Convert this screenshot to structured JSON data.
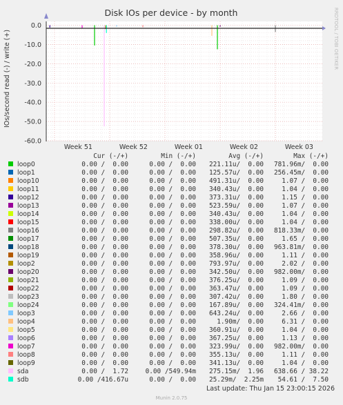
{
  "chart_data": {
    "type": "line",
    "title": "Disk IOs per device - by month",
    "ylabel": "IOs/second read (-) / write (+)",
    "side_label": "RRDTOOL / TOBI OETIKER",
    "ylim": [
      -60,
      2
    ],
    "y_ticks": [
      0,
      -10,
      -20,
      -30,
      -40,
      -50,
      -60
    ],
    "y_tick_labels": [
      "0.0",
      "-10.0",
      "-20.0",
      "-30.0",
      "-40.0",
      "-50.0",
      "-60.0"
    ],
    "x_ticks": [
      "Week 51",
      "Week 52",
      "Week 01",
      "Week 02",
      "Week 03"
    ],
    "grid": true,
    "spikes": [
      {
        "series": "loop12",
        "x": 0.013,
        "min": -1.2
      },
      {
        "series": "loop7",
        "x": 0.13,
        "min": -1.5
      },
      {
        "series": "loop0",
        "x": 0.175,
        "min": -10.5
      },
      {
        "series": "sda",
        "x": 0.21,
        "min": -52.5
      },
      {
        "series": "loop2",
        "x": 0.215,
        "min": -2.0
      },
      {
        "series": "sdb",
        "x": 0.218,
        "min": -4.0
      },
      {
        "series": "loop3",
        "x": 0.255,
        "min": -0.7
      },
      {
        "series": "loop8",
        "x": 0.35,
        "min": -1.0
      },
      {
        "series": "loop4",
        "x": 0.6,
        "min": -5.5
      },
      {
        "series": "loop0",
        "x": 0.62,
        "min": -12.5
      },
      {
        "series": "loop20",
        "x": 0.63,
        "min": -0.8
      },
      {
        "series": "loop16",
        "x": 0.83,
        "min": -3.5
      }
    ]
  },
  "legend": {
    "headers": {
      "cur": "Cur (-/+)",
      "min": "Min (-/+)",
      "avg": "Avg (-/+)",
      "max": "Max (-/+)"
    },
    "rows": [
      {
        "name": "loop0",
        "color": "#00cc00",
        "cur": "0.00 /  0.00",
        "min": "0.00 /  0.00",
        "avg": "221.11u/  0.00",
        "max": "781.96m/  0.00"
      },
      {
        "name": "loop1",
        "color": "#0066b3",
        "cur": "0.00 /  0.00",
        "min": "0.00 /  0.00",
        "avg": "125.57u/  0.00",
        "max": "256.45m/  0.00"
      },
      {
        "name": "loop10",
        "color": "#ff8000",
        "cur": "0.00 /  0.00",
        "min": "0.00 /  0.00",
        "avg": "491.31u/  0.00",
        "max": "1.07 /  0.00"
      },
      {
        "name": "loop11",
        "color": "#ffcc00",
        "cur": "0.00 /  0.00",
        "min": "0.00 /  0.00",
        "avg": "340.43u/  0.00",
        "max": "1.04 /  0.00"
      },
      {
        "name": "loop12",
        "color": "#330099",
        "cur": "0.00 /  0.00",
        "min": "0.00 /  0.00",
        "avg": "373.31u/  0.00",
        "max": "1.15 /  0.00"
      },
      {
        "name": "loop13",
        "color": "#990099",
        "cur": "0.00 /  0.00",
        "min": "0.00 /  0.00",
        "avg": "523.59u/  0.00",
        "max": "1.07 /  0.00"
      },
      {
        "name": "loop14",
        "color": "#ccff00",
        "cur": "0.00 /  0.00",
        "min": "0.00 /  0.00",
        "avg": "340.43u/  0.00",
        "max": "1.04 /  0.00"
      },
      {
        "name": "loop15",
        "color": "#ff0000",
        "cur": "0.00 /  0.00",
        "min": "0.00 /  0.00",
        "avg": "338.00u/  0.00",
        "max": "1.04 /  0.00"
      },
      {
        "name": "loop16",
        "color": "#808080",
        "cur": "0.00 /  0.00",
        "min": "0.00 /  0.00",
        "avg": "298.82u/  0.00",
        "max": "818.33m/  0.00"
      },
      {
        "name": "loop17",
        "color": "#008f00",
        "cur": "0.00 /  0.00",
        "min": "0.00 /  0.00",
        "avg": "507.35u/  0.00",
        "max": "1.65 /  0.00"
      },
      {
        "name": "loop18",
        "color": "#00487d",
        "cur": "0.00 /  0.00",
        "min": "0.00 /  0.00",
        "avg": "378.30u/  0.00",
        "max": "963.81m/  0.00"
      },
      {
        "name": "loop19",
        "color": "#b35a00",
        "cur": "0.00 /  0.00",
        "min": "0.00 /  0.00",
        "avg": "358.96u/  0.00",
        "max": "1.11 /  0.00"
      },
      {
        "name": "loop2",
        "color": "#b38f00",
        "cur": "0.00 /  0.00",
        "min": "0.00 /  0.00",
        "avg": "793.97u/  0.00",
        "max": "2.02 /  0.00"
      },
      {
        "name": "loop20",
        "color": "#6b006b",
        "cur": "0.00 /  0.00",
        "min": "0.00 /  0.00",
        "avg": "342.50u/  0.00",
        "max": "982.00m/  0.00"
      },
      {
        "name": "loop21",
        "color": "#8fb300",
        "cur": "0.00 /  0.00",
        "min": "0.00 /  0.00",
        "avg": "376.25u/  0.00",
        "max": "1.09 /  0.00"
      },
      {
        "name": "loop22",
        "color": "#b30000",
        "cur": "0.00 /  0.00",
        "min": "0.00 /  0.00",
        "avg": "363.47u/  0.00",
        "max": "1.09 /  0.00"
      },
      {
        "name": "loop23",
        "color": "#bebebe",
        "cur": "0.00 /  0.00",
        "min": "0.00 /  0.00",
        "avg": "307.42u/  0.00",
        "max": "1.80 /  0.00"
      },
      {
        "name": "loop24",
        "color": "#80ff80",
        "cur": "0.00 /  0.00",
        "min": "0.00 /  0.00",
        "avg": "167.89u/  0.00",
        "max": "324.41m/  0.00"
      },
      {
        "name": "loop3",
        "color": "#80c9ff",
        "cur": "0.00 /  0.00",
        "min": "0.00 /  0.00",
        "avg": "643.24u/  0.00",
        "max": "2.66 /  0.00"
      },
      {
        "name": "loop4",
        "color": "#ffc080",
        "cur": "0.00 /  0.00",
        "min": "0.00 /  0.00",
        "avg": "1.90m/  0.00",
        "max": "6.31 /  0.00"
      },
      {
        "name": "loop5",
        "color": "#ffe680",
        "cur": "0.00 /  0.00",
        "min": "0.00 /  0.00",
        "avg": "360.91u/  0.00",
        "max": "1.04 /  0.00"
      },
      {
        "name": "loop6",
        "color": "#aa80ff",
        "cur": "0.00 /  0.00",
        "min": "0.00 /  0.00",
        "avg": "367.25u/  0.00",
        "max": "1.13 /  0.00"
      },
      {
        "name": "loop7",
        "color": "#ee00cc",
        "cur": "0.00 /  0.00",
        "min": "0.00 /  0.00",
        "avg": "323.99u/  0.00",
        "max": "982.00m/  0.00"
      },
      {
        "name": "loop8",
        "color": "#ff8080",
        "cur": "0.00 /  0.00",
        "min": "0.00 /  0.00",
        "avg": "355.13u/  0.00",
        "max": "1.11 /  0.00"
      },
      {
        "name": "loop9",
        "color": "#666600",
        "cur": "0.00 /  0.00",
        "min": "0.00 /  0.00",
        "avg": "341.13u/  0.00",
        "max": "1.04 /  0.00"
      },
      {
        "name": "sda",
        "color": "#ffbfff",
        "cur": "0.00 /  1.72",
        "min": "0.00 /549.94m",
        "avg": "275.15m/  1.96",
        "max": "638.66 / 38.22"
      },
      {
        "name": "sdb",
        "color": "#00ffcc",
        "cur": "0.00 /416.67u",
        "min": "0.00 /  0.00",
        "avg": "25.29m/  2.25m",
        "max": "54.61 /  7.50"
      }
    ]
  },
  "footer": {
    "last_update": "Last update: Thu Jan 15 23:00:15 2026",
    "version": "Munin 2.0.75"
  }
}
